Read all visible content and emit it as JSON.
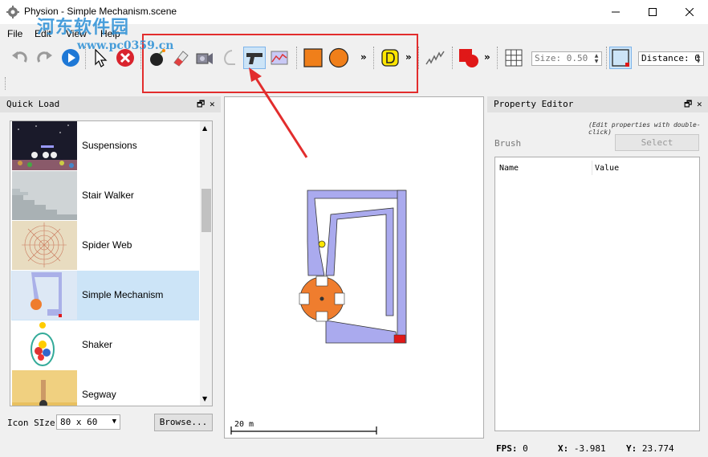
{
  "window": {
    "title": "Physion - Simple Mechanism.scene",
    "minimize_label": "—",
    "maximize_label": "☐",
    "close_label": "✕"
  },
  "menu": [
    "File",
    "Edit",
    "View",
    "Help"
  ],
  "watermark": {
    "title": "河东软件园",
    "url": "www.pc0359.cn"
  },
  "toolbar": {
    "icons": [
      "undo-icon",
      "redo-icon",
      "play-icon",
      "pointer-icon",
      "delete-icon",
      "bomb-icon",
      "eraser-icon",
      "camera-icon",
      "hook-icon",
      "gun-icon",
      "graph-icon",
      "square-icon",
      "circle-icon",
      "d-icon",
      "spring-icon",
      "shape-brush-icon",
      "grid-icon",
      "box-outline-icon"
    ],
    "more": "»",
    "size_label": "Size: 0.50",
    "distance_label": "Distance: 0"
  },
  "quick_load": {
    "title": "Quick Load",
    "items": [
      {
        "label": "Suspensions"
      },
      {
        "label": "Stair Walker"
      },
      {
        "label": "Spider Web"
      },
      {
        "label": "Simple Mechanism"
      },
      {
        "label": "Shaker"
      },
      {
        "label": "Segway"
      }
    ],
    "selected_index": 3,
    "icon_size_label": "Icon SIze",
    "icon_size_value": "80 x 60",
    "browse_label": "Browse..."
  },
  "canvas": {
    "scale_label": "20 m"
  },
  "property_editor": {
    "title": "Property Editor",
    "hint": "(Edit properties with double-click)",
    "brush_label": "Brush",
    "select_label": "Select",
    "col_name": "Name",
    "col_value": "Value"
  },
  "status": {
    "fps_label": "FPS:",
    "fps_value": "0",
    "x_label": "X:",
    "x_value": "-3.981",
    "y_label": "Y:",
    "y_value": "23.774"
  },
  "colors": {
    "accent": "#e22d2d",
    "shape_fill": "#aaaaee",
    "gear": "#ef7d2e",
    "selection": "#cce4f7"
  }
}
